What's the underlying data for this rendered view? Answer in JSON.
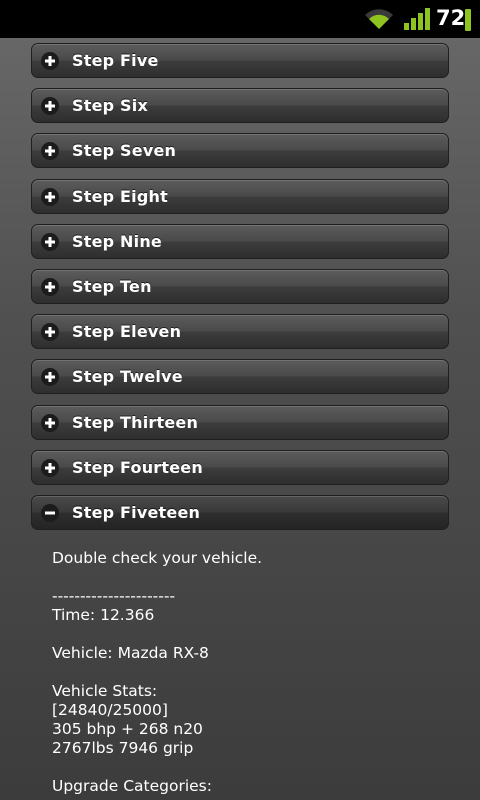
{
  "status_bar": {
    "wifi_icon": "wifi-icon",
    "signal_icon": "signal-icon",
    "battery_level": "72",
    "battery_color": "#8fc31f"
  },
  "steps": [
    {
      "label": "Step Five",
      "icon": "plus-icon"
    },
    {
      "label": "Step Six",
      "icon": "plus-icon"
    },
    {
      "label": "Step Seven",
      "icon": "plus-icon"
    },
    {
      "label": "Step Eight",
      "icon": "plus-icon"
    },
    {
      "label": "Step Nine",
      "icon": "plus-icon"
    },
    {
      "label": "Step Ten",
      "icon": "plus-icon"
    },
    {
      "label": "Step Eleven",
      "icon": "plus-icon"
    },
    {
      "label": "Step Twelve",
      "icon": "plus-icon"
    },
    {
      "label": "Step Thirteen",
      "icon": "plus-icon"
    },
    {
      "label": "Step Fourteen",
      "icon": "plus-icon"
    },
    {
      "label": "Step Fiveteen",
      "icon": "minus-icon",
      "expanded": true
    }
  ],
  "expanded_content": {
    "intro": "Double check your vehicle.",
    "separator": "----------------------",
    "time": "Time: 12.366",
    "vehicle": "Vehicle: Mazda RX-8",
    "stats_heading": "Vehicle Stats:",
    "stats_score": "[24840/25000]",
    "stats_power": "305 bhp + 268 n20",
    "stats_weight": "2767lbs 7946 grip",
    "upgrade_heading": "Upgrade Categories:"
  }
}
